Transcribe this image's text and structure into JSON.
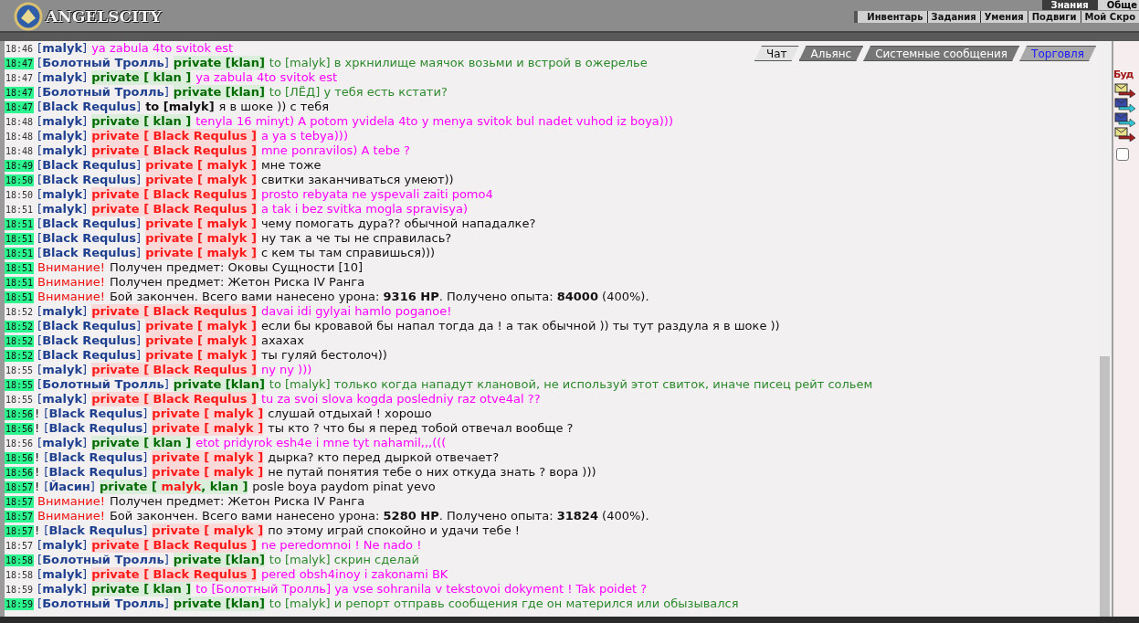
{
  "header": {
    "logo": "ANGELSCITY",
    "top_links": [
      "Знания",
      "Обще"
    ],
    "menu": [
      "Инвентарь",
      "Задания",
      "Умения",
      "Подвиги",
      "Мой Скро"
    ]
  },
  "tabs": [
    {
      "label": "Чат",
      "selected": true,
      "kind": "channel"
    },
    {
      "label": "Альянс",
      "selected": false,
      "kind": "channel"
    },
    {
      "label": "Системные сообщения",
      "selected": false,
      "kind": "channel"
    },
    {
      "label": "Торговля",
      "selected": false,
      "kind": "trade"
    }
  ],
  "messages": [
    {
      "time": "18:46",
      "fresh": false,
      "parts": [
        {
          "kind": "sender",
          "text": "[**malyk**]"
        },
        {
          "kind": "pink",
          "text": "ya zabula 4to svitok est"
        }
      ]
    },
    {
      "time": "18:47",
      "fresh": true,
      "parts": [
        {
          "kind": "sender",
          "text": "[**Болотный Тролль**]"
        },
        {
          "kind": "private-green",
          "text": "private [klan]"
        },
        {
          "kind": "green",
          "text": "to [malyk] в хркнилище маячок возьми и встрой в ожерелье"
        }
      ]
    },
    {
      "time": "18:47",
      "fresh": false,
      "parts": [
        {
          "kind": "sender",
          "text": "[**malyk**]"
        },
        {
          "kind": "private-green",
          "text": "private [ klan ]"
        },
        {
          "kind": "pink",
          "text": "ya zabula 4to svitok est"
        }
      ]
    },
    {
      "time": "18:47",
      "fresh": true,
      "parts": [
        {
          "kind": "sender",
          "text": "[**Болотный Тролль**]"
        },
        {
          "kind": "private-green",
          "text": "private [klan]"
        },
        {
          "kind": "green",
          "text": "to [ЛЁД] у тебя есть кстати?"
        }
      ]
    },
    {
      "time": "18:47",
      "fresh": true,
      "parts": [
        {
          "kind": "sender",
          "text": "[**Black Requlus**]"
        },
        {
          "kind": "to",
          "text": "to [malyk]"
        },
        {
          "kind": "dark",
          "text": "я в шоке )) с тебя"
        }
      ]
    },
    {
      "time": "18:48",
      "fresh": false,
      "parts": [
        {
          "kind": "sender",
          "text": "[**malyk**]"
        },
        {
          "kind": "private-green",
          "text": "private [ klan ]"
        },
        {
          "kind": "pink",
          "text": "tenyla 16 minyt) A potom yvidela 4to y menya svitok bul nadet vuhod iz boya)))"
        }
      ]
    },
    {
      "time": "18:48",
      "fresh": false,
      "parts": [
        {
          "kind": "sender",
          "text": "[**malyk**]"
        },
        {
          "kind": "private-red",
          "text": "private [ Black Requlus ]"
        },
        {
          "kind": "pink",
          "text": "a ya s tebya)))"
        }
      ]
    },
    {
      "time": "18:48",
      "fresh": false,
      "parts": [
        {
          "kind": "sender",
          "text": "[**malyk**]"
        },
        {
          "kind": "private-red",
          "text": "private [ Black Requlus ]"
        },
        {
          "kind": "pink",
          "text": "mne ponravilos) A tebe ?"
        }
      ]
    },
    {
      "time": "18:49",
      "fresh": true,
      "parts": [
        {
          "kind": "sender",
          "text": "[**Black Requlus**]"
        },
        {
          "kind": "private-red",
          "text": "private [ malyk ]"
        },
        {
          "kind": "dark",
          "text": "мне тоже"
        }
      ]
    },
    {
      "time": "18:50",
      "fresh": true,
      "parts": [
        {
          "kind": "sender",
          "text": "[**Black Requlus**]"
        },
        {
          "kind": "private-red",
          "text": "private [ malyk ]"
        },
        {
          "kind": "dark",
          "text": "свитки заканчиваться умеют))"
        }
      ]
    },
    {
      "time": "18:50",
      "fresh": false,
      "parts": [
        {
          "kind": "sender",
          "text": "[**malyk**]"
        },
        {
          "kind": "private-red",
          "text": "private [ Black Requlus ]"
        },
        {
          "kind": "pink",
          "text": "prosto rebyata ne yspevali zaiti pomo4"
        }
      ]
    },
    {
      "time": "18:51",
      "fresh": false,
      "parts": [
        {
          "kind": "sender",
          "text": "[**malyk**]"
        },
        {
          "kind": "private-red",
          "text": "private [ Black Requlus ]"
        },
        {
          "kind": "pink",
          "text": "a tak i bez svitka mogla spravisya)"
        }
      ]
    },
    {
      "time": "18:51",
      "fresh": true,
      "parts": [
        {
          "kind": "sender",
          "text": "[**Black Requlus**]"
        },
        {
          "kind": "private-red",
          "text": "private [ malyk ]"
        },
        {
          "kind": "dark",
          "text": "чему помогать дура?? обычной нападалке?"
        }
      ]
    },
    {
      "time": "18:51",
      "fresh": true,
      "parts": [
        {
          "kind": "sender",
          "text": "[**Black Requlus**]"
        },
        {
          "kind": "private-red",
          "text": "private [ malyk ]"
        },
        {
          "kind": "dark",
          "text": "ну так а че ты не справилась?"
        }
      ]
    },
    {
      "time": "18:51",
      "fresh": true,
      "parts": [
        {
          "kind": "sender",
          "text": "[**Black Requlus**]"
        },
        {
          "kind": "private-red",
          "text": "private [ malyk ]"
        },
        {
          "kind": "dark",
          "text": "с кем ты там справишься)))"
        }
      ]
    },
    {
      "time": "18:51",
      "fresh": true,
      "parts": [
        {
          "kind": "alert",
          "text": "Внимание!"
        },
        {
          "kind": "system",
          "text": "Получен предмет: Оковы Сущности [10]"
        }
      ]
    },
    {
      "time": "18:51",
      "fresh": true,
      "parts": [
        {
          "kind": "alert",
          "text": "Внимание!"
        },
        {
          "kind": "system",
          "text": "Получен предмет: Жетон Риска IV Ранга"
        }
      ]
    },
    {
      "time": "18:51",
      "fresh": true,
      "parts": [
        {
          "kind": "alert",
          "text": "Внимание!"
        },
        {
          "kind": "system",
          "text": "Бой закончен. Всего вами нанесено урона: **9316 HP**. Получено опыта: **84000** (400%)."
        }
      ]
    },
    {
      "time": "18:52",
      "fresh": false,
      "parts": [
        {
          "kind": "sender",
          "text": "[**malyk**]"
        },
        {
          "kind": "private-red",
          "text": "private [ Black Requlus ]"
        },
        {
          "kind": "pink",
          "text": "davai idi gylyai hamlo poganoe!"
        }
      ]
    },
    {
      "time": "18:52",
      "fresh": true,
      "parts": [
        {
          "kind": "sender",
          "text": "[**Black Requlus**]"
        },
        {
          "kind": "private-red",
          "text": "private [ malyk ]"
        },
        {
          "kind": "dark",
          "text": "если бы кровавой бы напал тогда да ! а так обычной )) ты тут раздула я в шоке ))"
        }
      ]
    },
    {
      "time": "18:52",
      "fresh": true,
      "parts": [
        {
          "kind": "sender",
          "text": "[**Black Requlus**]"
        },
        {
          "kind": "private-red",
          "text": "private [ malyk ]"
        },
        {
          "kind": "dark",
          "text": "ахахах"
        }
      ]
    },
    {
      "time": "18:52",
      "fresh": true,
      "parts": [
        {
          "kind": "sender",
          "text": "[**Black Requlus**]"
        },
        {
          "kind": "private-red",
          "text": "private [ malyk ]"
        },
        {
          "kind": "dark",
          "text": "ты гуляй бестолоч))"
        }
      ]
    },
    {
      "time": "18:55",
      "fresh": false,
      "parts": [
        {
          "kind": "sender",
          "text": "[**malyk**]"
        },
        {
          "kind": "private-red",
          "text": "private [ Black Requlus ]"
        },
        {
          "kind": "pink",
          "text": "ny ny )))"
        }
      ]
    },
    {
      "time": "18:55",
      "fresh": true,
      "parts": [
        {
          "kind": "sender",
          "text": "[**Болотный Тролль**]"
        },
        {
          "kind": "private-green",
          "text": "private [klan]"
        },
        {
          "kind": "green",
          "text": "to [malyk] только когда нападут клановой, не используй этот свиток, иначе писец рейт сольем"
        }
      ]
    },
    {
      "time": "18:55",
      "fresh": false,
      "parts": [
        {
          "kind": "sender",
          "text": "[**malyk**]"
        },
        {
          "kind": "private-red",
          "text": "private [ Black Requlus ]"
        },
        {
          "kind": "pink",
          "text": "tu za svoi slova kogda posledniy raz otve4al ??"
        }
      ]
    },
    {
      "time": "18:56",
      "fresh": true,
      "prefix": "!",
      "parts": [
        {
          "kind": "sender",
          "text": "[**Black Requlus**]"
        },
        {
          "kind": "private-red",
          "text": "private [ malyk ]"
        },
        {
          "kind": "dark",
          "text": "слушай отдыхай ! хорошо"
        }
      ]
    },
    {
      "time": "18:56",
      "fresh": true,
      "prefix": "!",
      "parts": [
        {
          "kind": "sender",
          "text": "[**Black Requlus**]"
        },
        {
          "kind": "private-red",
          "text": "private [ malyk ]"
        },
        {
          "kind": "dark",
          "text": "ты кто ? что бы я перед тобой отвечал вообще ?"
        }
      ]
    },
    {
      "time": "18:56",
      "fresh": false,
      "parts": [
        {
          "kind": "sender",
          "text": "[**malyk**]"
        },
        {
          "kind": "private-green",
          "text": "private [ klan ]"
        },
        {
          "kind": "pink",
          "text": "etot pridyrok esh4e i mne tyt nahamil,,,((("
        }
      ]
    },
    {
      "time": "18:56",
      "fresh": true,
      "prefix": "!",
      "parts": [
        {
          "kind": "sender",
          "text": "[**Black Requlus**]"
        },
        {
          "kind": "private-red",
          "text": "private [ malyk ]"
        },
        {
          "kind": "dark",
          "text": "дырка? кто перед дыркой отвечает?"
        }
      ]
    },
    {
      "time": "18:56",
      "fresh": true,
      "prefix": "!",
      "parts": [
        {
          "kind": "sender",
          "text": "[**Black Requlus**]"
        },
        {
          "kind": "private-red",
          "text": "private [ malyk ]"
        },
        {
          "kind": "dark",
          "text": "не путай понятия тебе о них откуда знать ? вора )))"
        }
      ]
    },
    {
      "time": "18:57",
      "fresh": true,
      "prefix": "!",
      "parts": [
        {
          "kind": "sender",
          "text": "[**Йасин**]"
        },
        {
          "kind": "private-mixed",
          "text": "private [ **malyk**, klan ]"
        },
        {
          "kind": "dark",
          "text": "posle boya paydom pinat yevo"
        }
      ]
    },
    {
      "time": "18:57",
      "fresh": true,
      "parts": [
        {
          "kind": "alert",
          "text": "Внимание!"
        },
        {
          "kind": "system",
          "text": "Получен предмет: Жетон Риска IV Ранга"
        }
      ]
    },
    {
      "time": "18:57",
      "fresh": true,
      "parts": [
        {
          "kind": "alert",
          "text": "Внимание!"
        },
        {
          "kind": "system",
          "text": "Бой закончен. Всего вами нанесено урона: **5280 HP**. Получено опыта: **31824** (400%)."
        }
      ]
    },
    {
      "time": "18:57",
      "fresh": true,
      "prefix": "!",
      "parts": [
        {
          "kind": "sender",
          "text": "[**Black Requlus**]"
        },
        {
          "kind": "private-red",
          "text": "private [ malyk ]"
        },
        {
          "kind": "dark",
          "text": "по этому играй спокойно и удачи тебе !"
        }
      ]
    },
    {
      "time": "18:57",
      "fresh": false,
      "parts": [
        {
          "kind": "sender",
          "text": "[**malyk**]"
        },
        {
          "kind": "private-red",
          "text": "private [ Black Requlus ]"
        },
        {
          "kind": "pink",
          "text": "ne peredomnoi ! Ne nado !"
        }
      ]
    },
    {
      "time": "18:58",
      "fresh": true,
      "parts": [
        {
          "kind": "sender",
          "text": "[**Болотный Тролль**]"
        },
        {
          "kind": "private-green",
          "text": "private [klan]"
        },
        {
          "kind": "green",
          "text": "to [malyk] скрин сделай"
        }
      ]
    },
    {
      "time": "18:58",
      "fresh": false,
      "parts": [
        {
          "kind": "sender",
          "text": "[**malyk**]"
        },
        {
          "kind": "private-red",
          "text": "private [ Black Requlus ]"
        },
        {
          "kind": "pink",
          "text": "pered obsh4inoy i zakonami BK"
        }
      ]
    },
    {
      "time": "18:59",
      "fresh": false,
      "parts": [
        {
          "kind": "sender",
          "text": "[**malyk**]"
        },
        {
          "kind": "private-green",
          "text": "private [ klan ]"
        },
        {
          "kind": "pink",
          "text": "to [Болотный Тролль] ya vse sohranila v tekstovoi dokyment ! Tak poidet ?"
        }
      ]
    },
    {
      "time": "18:59",
      "fresh": true,
      "parts": [
        {
          "kind": "sender",
          "text": "[**Болотный Тролль**]"
        },
        {
          "kind": "private-green",
          "text": "private [klan]"
        },
        {
          "kind": "green",
          "text": "to [malyk] и репорт отправь сообщения где он матерился или обызывался"
        }
      ]
    }
  ],
  "side_panel": {
    "heading": "Буд",
    "checkbox": {
      "checked": false
    }
  }
}
